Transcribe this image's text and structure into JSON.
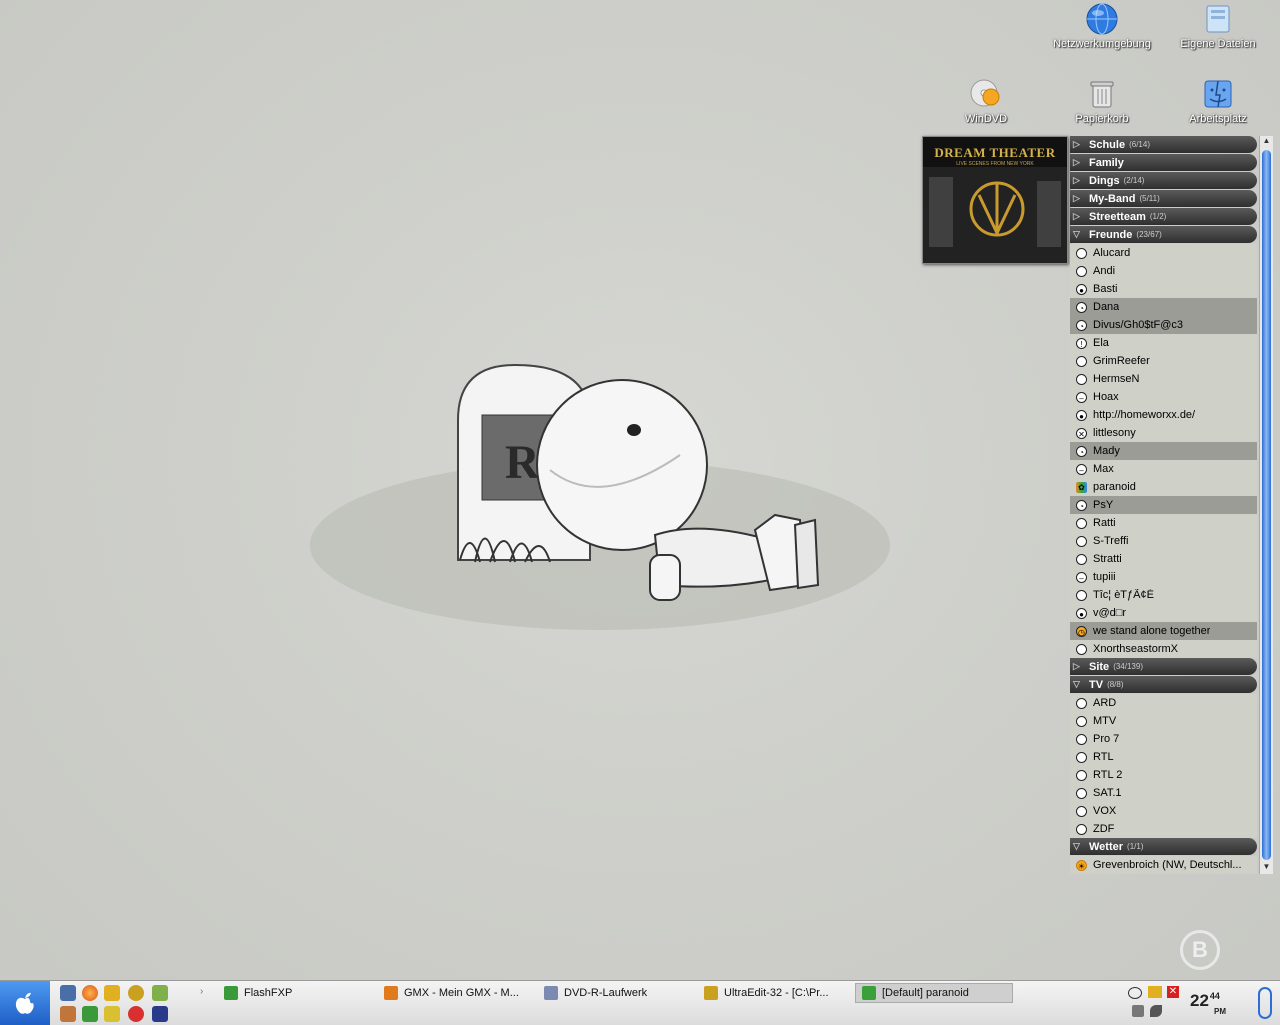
{
  "desktop_icons": {
    "network": "Netzwerkumgebung",
    "my_files": "Eigene Dateien",
    "windvd": "WinDVD",
    "recycle": "Papierkorb",
    "workplace": "Arbeitsplatz"
  },
  "album_art": {
    "band": "DREAM THEATER",
    "subtitle": "LIVE SCENES FROM NEW YORK"
  },
  "buddy_list": {
    "groups": [
      {
        "name": "Schule",
        "count": "(6/14)",
        "expanded": false,
        "buddies": []
      },
      {
        "name": "Family",
        "count": "",
        "expanded": false,
        "buddies": []
      },
      {
        "name": "Dings",
        "count": "(2/14)",
        "expanded": false,
        "buddies": []
      },
      {
        "name": "My-Band",
        "count": "(5/11)",
        "expanded": false,
        "buddies": []
      },
      {
        "name": "Streetteam",
        "count": "(1/2)",
        "expanded": false,
        "buddies": []
      },
      {
        "name": "Freunde",
        "count": "(23/67)",
        "expanded": true,
        "buddies": [
          {
            "name": "Alucard",
            "status": "online"
          },
          {
            "name": "Andi",
            "status": "online"
          },
          {
            "name": "Basti",
            "status": "dnd"
          },
          {
            "name": "Dana",
            "status": "away",
            "dark": true
          },
          {
            "name": "Divus/Gh0$tF@c3",
            "status": "away",
            "dark": true
          },
          {
            "name": "Ela",
            "status": "attention"
          },
          {
            "name": "GrimReefer",
            "status": "online"
          },
          {
            "name": "HermseN",
            "status": "online"
          },
          {
            "name": "Hoax",
            "status": "busy"
          },
          {
            "name": "http://homeworxx.de/",
            "status": "dnd"
          },
          {
            "name": "littlesony",
            "status": "offline"
          },
          {
            "name": "Mady",
            "status": "away",
            "dark": true
          },
          {
            "name": "Max",
            "status": "busy"
          },
          {
            "name": "paranoid",
            "status": "icq"
          },
          {
            "name": "PsY",
            "status": "away",
            "dark": true
          },
          {
            "name": "Ratti",
            "status": "online"
          },
          {
            "name": "S-Treffi",
            "status": "online"
          },
          {
            "name": "Stratti",
            "status": "online"
          },
          {
            "name": "tupiii",
            "status": "busy"
          },
          {
            "name": "Tîc¦ èTƒÃ¢É",
            "status": "online"
          },
          {
            "name": "v@d□r",
            "status": "dnd"
          },
          {
            "name": "we stand alone together",
            "status": "clock",
            "dark": true
          },
          {
            "name": "XnorthseastormX",
            "status": "online"
          }
        ]
      },
      {
        "name": "Site",
        "count": "(34/139)",
        "expanded": false,
        "buddies": []
      },
      {
        "name": "TV",
        "count": "(8/8)",
        "expanded": true,
        "buddies": [
          {
            "name": "ARD",
            "status": "online"
          },
          {
            "name": "MTV",
            "status": "online"
          },
          {
            "name": "Pro 7",
            "status": "online"
          },
          {
            "name": "RTL",
            "status": "online"
          },
          {
            "name": "RTL 2",
            "status": "online"
          },
          {
            "name": "SAT.1",
            "status": "online"
          },
          {
            "name": "VOX",
            "status": "online"
          },
          {
            "name": "ZDF",
            "status": "online"
          }
        ]
      },
      {
        "name": "Wetter",
        "count": "(1/1)",
        "expanded": true,
        "buddies": [
          {
            "name": "Grevenbroich (NW, Deutschl...",
            "status": "weather"
          }
        ]
      }
    ]
  },
  "taskbar": {
    "start_glyph": "",
    "tasks": [
      {
        "label": "FlashFXP",
        "color": "#3a9a3a",
        "active": false
      },
      {
        "label": "GMX - Mein GMX - M...",
        "color": "#e07a1c",
        "active": false
      },
      {
        "label": "DVD-R-Laufwerk",
        "color": "#7a8ab0",
        "active": false
      },
      {
        "label": "UltraEdit-32 - [C:\\Pr...",
        "color": "#c9a020",
        "active": false
      },
      {
        "label": "[Default] paranoid",
        "color": "#3aa03a",
        "active": true
      }
    ],
    "clock_hour": "22",
    "clock_minute": "44",
    "clock_ampm": "PM"
  },
  "colors": {
    "desktop_bg": "#cfd0cb",
    "group_header": "#3a3a3a",
    "buddy_row": "#cfd0c8",
    "buddy_row_dark": "#9b9c96",
    "scrollbar_thumb": "#2a6fd6"
  }
}
